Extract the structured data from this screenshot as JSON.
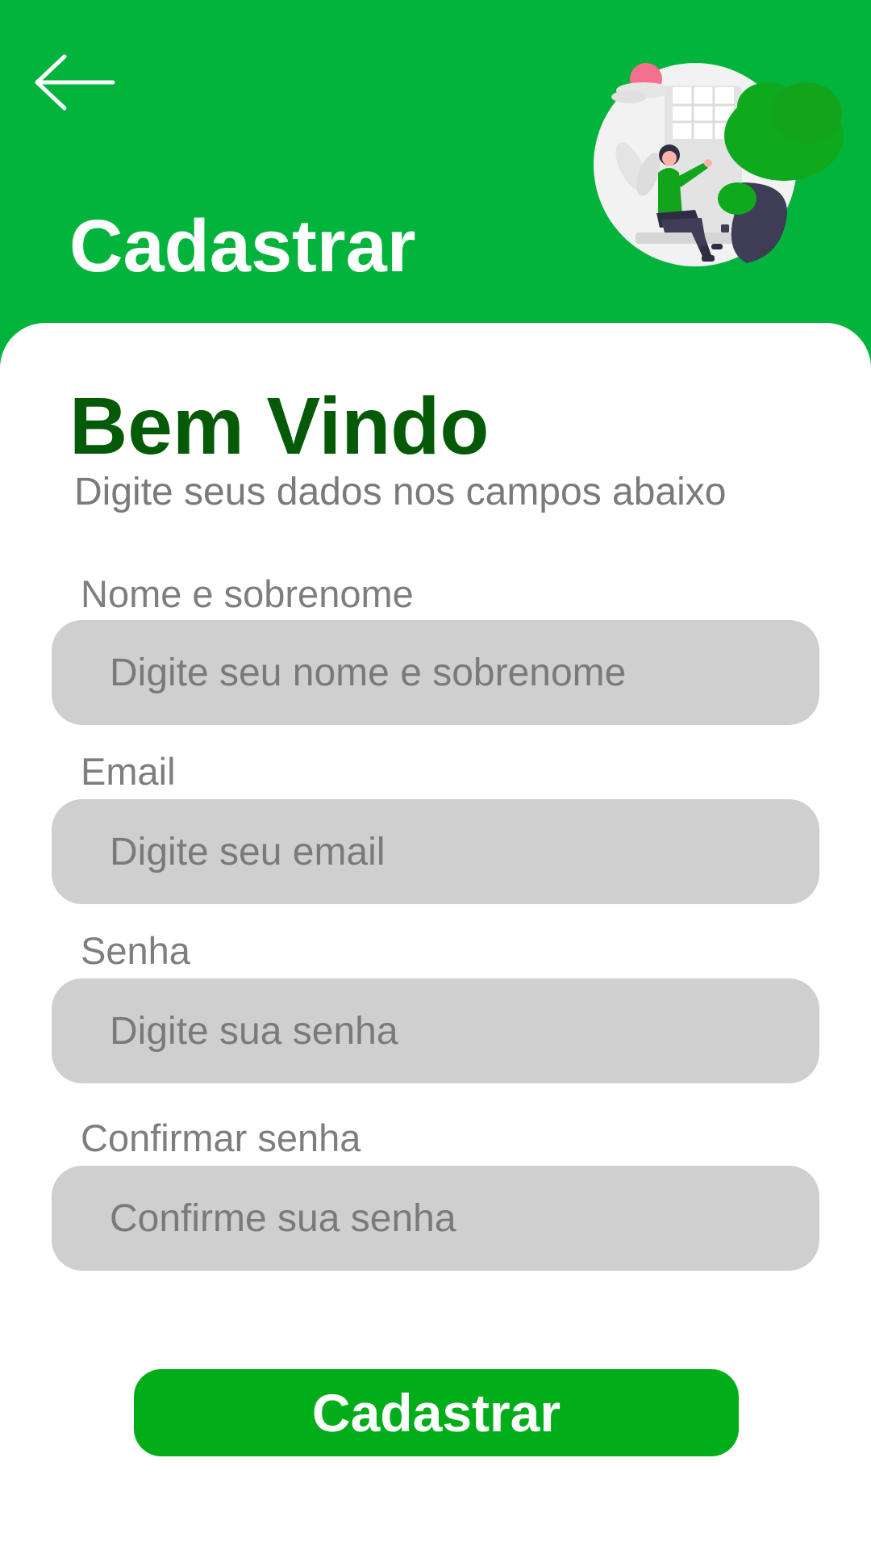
{
  "header": {
    "back_icon": "arrow-left-icon",
    "title": "Cadastrar",
    "illustration": "woman-window-tree-illustration"
  },
  "welcome": {
    "title": "Bem Vindo",
    "subtitle": "Digite seus dados nos campos abaixo"
  },
  "form": {
    "fields": [
      {
        "label": "Nome e sobrenome",
        "placeholder": "Digite seu nome e sobrenome",
        "value": ""
      },
      {
        "label": "Email",
        "placeholder": "Digite seu email",
        "value": ""
      },
      {
        "label": "Senha",
        "placeholder": "Digite sua senha",
        "value": ""
      },
      {
        "label": "Confirmar senha",
        "placeholder": "Confirme sua senha",
        "value": ""
      }
    ],
    "submit_label": "Cadastrar"
  },
  "colors": {
    "header_green": "#02b43c",
    "button_green": "#01ad18",
    "title_dark_green": "#045a06",
    "input_gray": "#cfcfcf",
    "text_gray": "#7a7a7a"
  }
}
